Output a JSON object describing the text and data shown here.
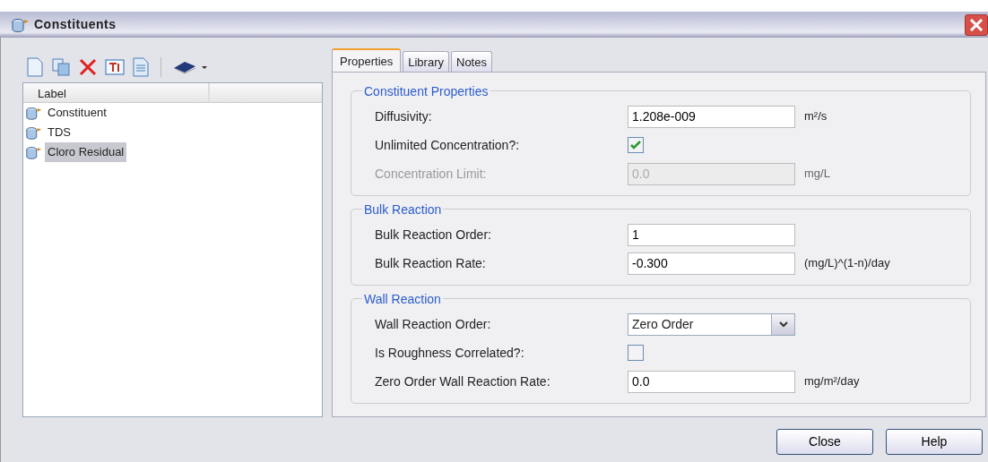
{
  "window": {
    "title": "Constituents"
  },
  "list": {
    "column": "Label",
    "items": [
      {
        "label": "Constituent",
        "selected": false
      },
      {
        "label": "TDS",
        "selected": false
      },
      {
        "label": "Cloro Residual",
        "selected": true
      }
    ]
  },
  "tabs": [
    {
      "label": "Properties",
      "selected": true
    },
    {
      "label": "Library",
      "selected": false
    },
    {
      "label": "Notes",
      "selected": false
    }
  ],
  "groups": [
    {
      "title": "Constituent Properties",
      "fields": [
        {
          "kind": "text",
          "label": "Diffusivity:",
          "value": "1.208e-009",
          "unit": "m²/s",
          "disabled": false
        },
        {
          "kind": "checkbox",
          "label": "Unlimited Concentration?:",
          "checked": true
        },
        {
          "kind": "text",
          "label": "Concentration Limit:",
          "value": "0.0",
          "unit": "mg/L",
          "disabled": true
        }
      ]
    },
    {
      "title": "Bulk Reaction",
      "fields": [
        {
          "kind": "text",
          "label": "Bulk Reaction Order:",
          "value": "1",
          "disabled": false
        },
        {
          "kind": "text",
          "label": "Bulk Reaction Rate:",
          "value": "-0.300",
          "unit": "(mg/L)^(1-n)/day",
          "disabled": false
        }
      ]
    },
    {
      "title": "Wall Reaction",
      "fields": [
        {
          "kind": "select",
          "label": "Wall Reaction Order:",
          "value": "Zero Order"
        },
        {
          "kind": "checkbox",
          "label": "Is Roughness Correlated?:",
          "checked": false
        },
        {
          "kind": "text",
          "label": "Zero Order Wall Reaction Rate:",
          "value": "0.0",
          "unit": "mg/m²/day",
          "disabled": false
        }
      ]
    }
  ],
  "buttons": [
    "Close",
    "Help"
  ]
}
